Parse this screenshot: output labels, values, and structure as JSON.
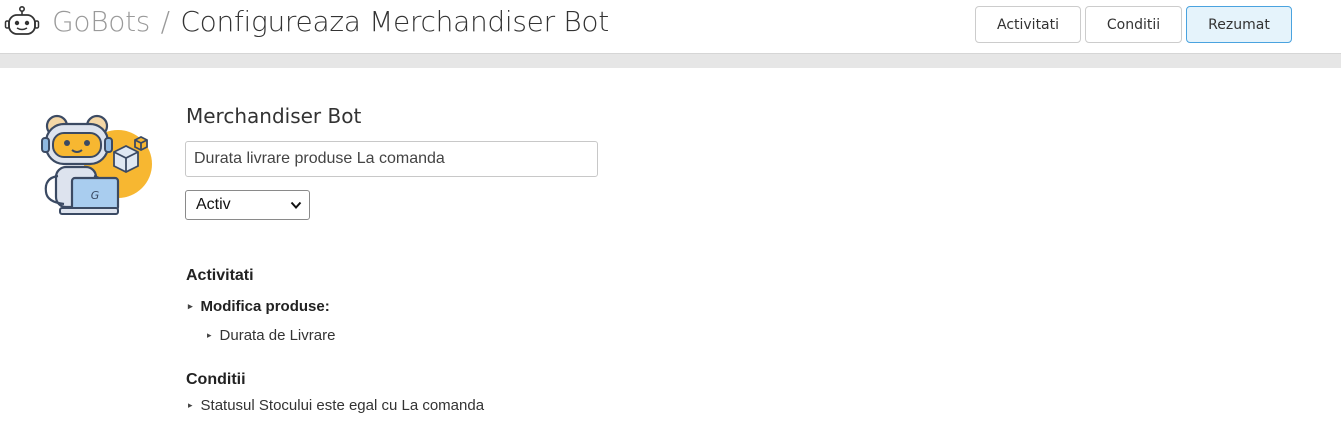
{
  "header": {
    "icon": "robot-icon",
    "brand": "GoBots",
    "separator": "/",
    "page_title": "Configureaza Merchandiser Bot"
  },
  "tabs": [
    {
      "label": "Activitati",
      "active": false
    },
    {
      "label": "Conditii",
      "active": false
    },
    {
      "label": "Rezumat",
      "active": true
    }
  ],
  "bot": {
    "illustration": "robot-with-laptop-illustration",
    "name": "Merchandiser Bot",
    "description_value": "Durata livrare produse La comanda",
    "status_selected": "Activ"
  },
  "summary": {
    "activities_title": "Activitati",
    "activity_group": "Modifica produse:",
    "activity_item": "Durata de Livrare",
    "conditions_title": "Conditii",
    "condition_item": "Statusul Stocului este egal cu La comanda"
  },
  "colors": {
    "active_tab_bg": "#e5f3fb",
    "active_tab_border": "#4aa3df",
    "band": "#e6e6e6",
    "illustration_accent": "#f7b731"
  }
}
